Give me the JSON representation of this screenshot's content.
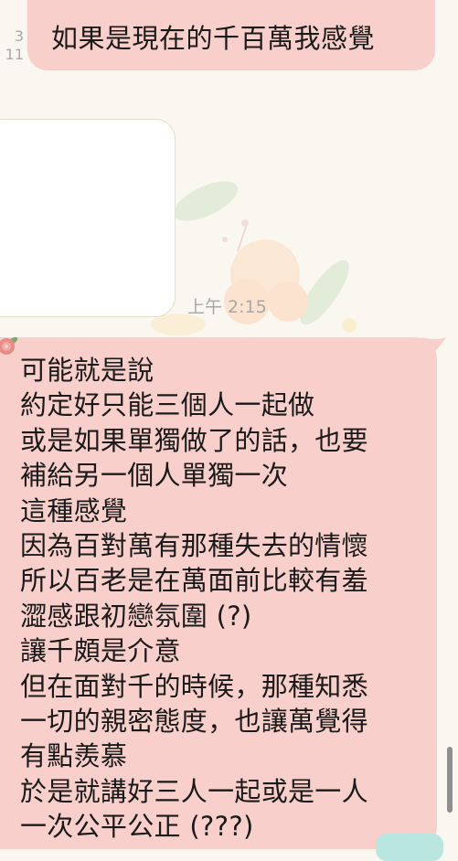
{
  "read_receipt": {
    "count": "3",
    "time": "11"
  },
  "messages": {
    "top_bubble": "如果是現在的千百萬我感覺",
    "timestamp": "上午 2:15",
    "main_bubble_lines": [
      "可能就是說",
      "約定好只能三個人一起做",
      "或是如果單獨做了的話，也要",
      "補給另一個人單獨一次",
      "這種感覺",
      "因為百對萬有那種失去的情懷",
      "所以百老是在萬面前比較有羞",
      "澀感跟初戀氛圍 (?)",
      "讓千頗是介意",
      "但在面對千的時候，那種知悉",
      "一切的親密態度，也讓萬覺得",
      "有點羨慕",
      "於是就講好三人一起或是一人",
      "一次公平公正 (???)"
    ]
  },
  "colors": {
    "background": "#faf7f1",
    "bubble": "#f8cfca",
    "text": "#1a1a1a",
    "timestamp": "#a7a7a7",
    "accent_button": "#b9e6e0"
  },
  "icons": {
    "avatar": "flower-icon"
  }
}
